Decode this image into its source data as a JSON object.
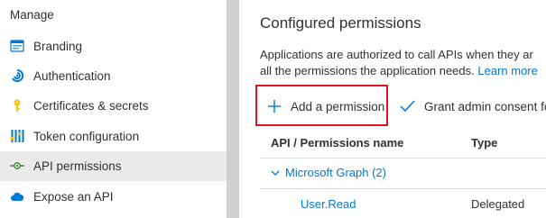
{
  "sidebar": {
    "header": "Manage",
    "items": [
      {
        "label": "Branding",
        "icon": "branding-icon"
      },
      {
        "label": "Authentication",
        "icon": "authentication-icon"
      },
      {
        "label": "Certificates & secrets",
        "icon": "key-icon"
      },
      {
        "label": "Token configuration",
        "icon": "token-config-icon"
      },
      {
        "label": "API permissions",
        "icon": "api-permissions-icon",
        "active": true
      },
      {
        "label": "Expose an API",
        "icon": "cloud-icon"
      }
    ]
  },
  "main": {
    "title": "Configured permissions",
    "description_line1": "Applications are authorized to call APIs when they ar",
    "description_line2": "all the permissions the application needs.",
    "learn_more": "Learn more",
    "toolbar": {
      "add_permission": "Add a permission",
      "grant_admin": "Grant admin consent fo"
    },
    "table": {
      "headers": [
        "API / Permissions name",
        "Type"
      ],
      "group": "Microsoft Graph (2)",
      "rows": [
        {
          "name": "User.Read",
          "type": "Delegated"
        }
      ]
    }
  },
  "colors": {
    "accent": "#0078d4",
    "highlight": "#e81123",
    "active_bg": "#ebeaea",
    "divider": "#d2d0ce"
  }
}
